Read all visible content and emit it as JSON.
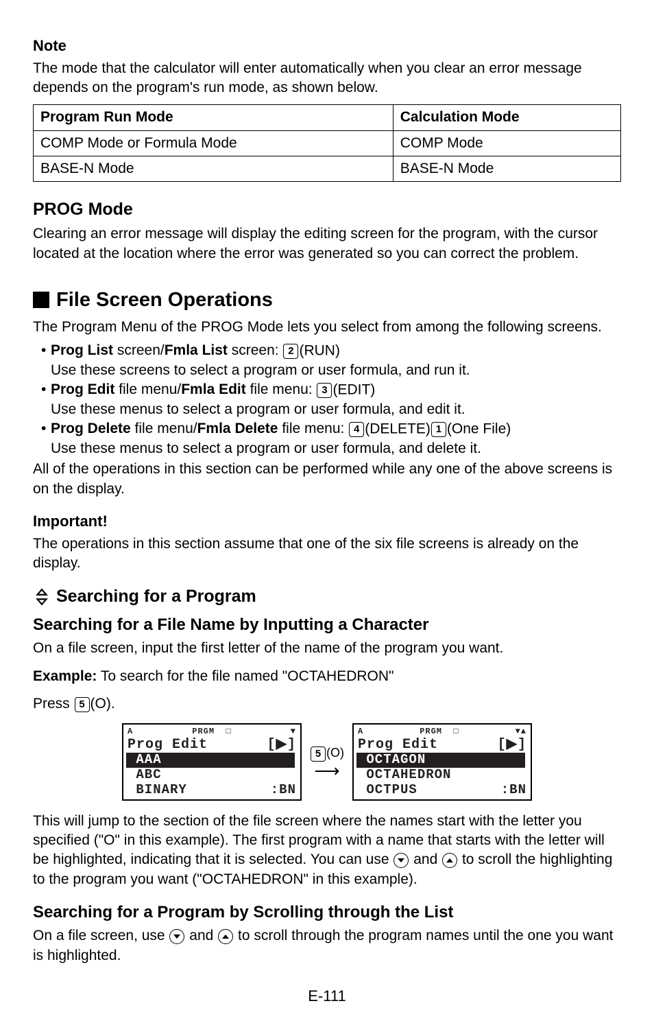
{
  "note": {
    "title": "Note",
    "body": "The mode that the calculator will enter automatically when you clear an error message depends on the program's run mode, as shown below."
  },
  "mode_table": {
    "headers": [
      "Program Run Mode",
      "Calculation Mode"
    ],
    "rows": [
      [
        "COMP Mode or Formula Mode",
        "COMP Mode"
      ],
      [
        "BASE-N Mode",
        "BASE-N Mode"
      ]
    ]
  },
  "prog_mode": {
    "title": "PROG Mode",
    "body": "Clearing an error message will display the editing screen for the program, with the cursor located at the location where the error was generated so you can correct the problem."
  },
  "file_ops": {
    "title": "File Screen Operations",
    "intro": "The Program Menu of the PROG Mode lets you select from among the following screens.",
    "bullets": [
      {
        "lead1": "Prog List",
        "mid1": " screen/",
        "lead2": "Fmla List",
        "mid2": " screen: ",
        "key": "2",
        "keylabel": "(RUN)",
        "sub": "Use these screens to select a program or user formula, and run it."
      },
      {
        "lead1": "Prog Edit",
        "mid1": " file menu/",
        "lead2": "Fmla Edit",
        "mid2": " file menu: ",
        "key": "3",
        "keylabel": "(EDIT)",
        "sub": "Use these menus to select a program or user formula, and edit it."
      },
      {
        "lead1": "Prog Delete",
        "mid1": " file menu/",
        "lead2": "Fmla Delete",
        "mid2": " file menu: ",
        "key": "4",
        "keylabel": "(DELETE)",
        "key2": "1",
        "keylabel2": "(One File)",
        "sub": "Use these menus to select a program or user formula, and delete it."
      }
    ],
    "outro": "All of the operations in this section can be performed while any one of the above screens is on the display."
  },
  "important": {
    "title": "Important!",
    "body": "The operations in this section assume that one of the six file screens is already on the display."
  },
  "searching": {
    "title": "Searching for a Program",
    "subtitle1": "Searching for a File Name by Inputting a Character",
    "body1": "On a file screen, input the first letter of the name of the program you want.",
    "example_label": "Example:",
    "example_text": " To search for the file named \"OCTAHEDRON\"",
    "press_pre": "Press ",
    "press_key": "5",
    "press_post": "(O).",
    "mid_key": "5",
    "mid_label": "(O)",
    "after_fig_a": "This will jump to the section of the file screen where the names start with the letter you specified (\"O\" in this example). The first program with a name that starts with the letter will be highlighted, indicating that it is selected. You can use ",
    "after_fig_b": " and ",
    "after_fig_c": " to scroll the highlighting to the program you want (\"OCTAHEDRON\" in this example).",
    "subtitle2": "Searching for a Program by Scrolling through the List",
    "body2_a": "On a file screen, use ",
    "body2_b": " and ",
    "body2_c": " to scroll through the program names until the one you want is highlighted."
  },
  "lcd": {
    "top_prgm": "PRGM",
    "title_text": "Prog Edit",
    "title_right": "[▶]",
    "bn": ":BN",
    "left": {
      "top_arrow": "▼",
      "highlight": "AAA",
      "row2": "ABC",
      "row3": "BINARY"
    },
    "right": {
      "top_arrow": "▼▲",
      "highlight": "OCTAGON",
      "row2": "OCTAHEDRON",
      "row3": "OCTPUS"
    }
  },
  "page": "E-111"
}
